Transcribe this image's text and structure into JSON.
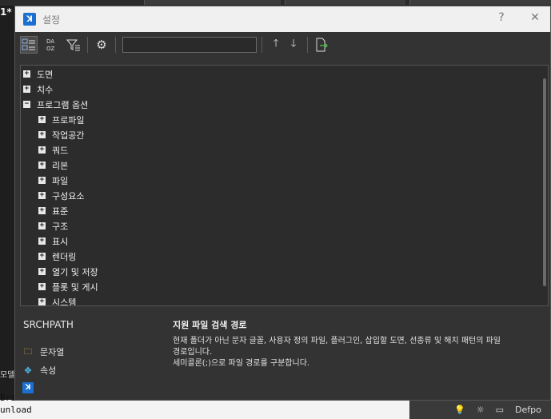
{
  "background": {
    "left_label": "1*",
    "left_label2": "모델",
    "cmd_line1": "  Bri",
    "cmd_line2": "unload",
    "status_layer": "Defpo"
  },
  "dialog": {
    "title": "설정",
    "help_label": "?",
    "close_label": "✕",
    "search": {
      "value": "",
      "placeholder": ""
    },
    "toolbar": {
      "categorized_icon": "categorized-icon",
      "alpha_sort_icon": "alphabetical-sort-icon",
      "filter_icon": "filter-icon",
      "settings_icon": "gear-icon",
      "prev_label": "🡑",
      "next_label": "🡓",
      "export_icon": "export-icon"
    },
    "tree": [
      {
        "label": "도면",
        "level": 0,
        "expander": "+"
      },
      {
        "label": "치수",
        "level": 0,
        "expander": "+"
      },
      {
        "label": "프로그램 옵션",
        "level": 0,
        "expander": "−"
      },
      {
        "label": "프로파일",
        "level": 1,
        "expander": "+"
      },
      {
        "label": "작업공간",
        "level": 1,
        "expander": "+"
      },
      {
        "label": "쿼드",
        "level": 1,
        "expander": "+"
      },
      {
        "label": "리본",
        "level": 1,
        "expander": "+"
      },
      {
        "label": "파일",
        "level": 1,
        "expander": "+"
      },
      {
        "label": "구성요소",
        "level": 1,
        "expander": "+"
      },
      {
        "label": "표준",
        "level": 1,
        "expander": "+"
      },
      {
        "label": "구조",
        "level": 1,
        "expander": "+"
      },
      {
        "label": "표시",
        "level": 1,
        "expander": "+"
      },
      {
        "label": "렌더링",
        "level": 1,
        "expander": "+"
      },
      {
        "label": "열기 및 저장",
        "level": 1,
        "expander": "+"
      },
      {
        "label": "플롯 및 게시",
        "level": 1,
        "expander": "+"
      },
      {
        "label": "시스템",
        "level": 1,
        "expander": "+"
      }
    ],
    "detail": {
      "variable": "SRCHPATH",
      "title": "지원 파일 검색 경로",
      "line1": "현재 폴더가 아닌 문자 글꼴, 사용자 정의 파일, 플러그인, 삽입할 도면, 선종류 및 해치 패턴의 파일",
      "line2": "경로입니다.",
      "line3": "세미콜론(;)으로 파일 경로를 구분합니다."
    },
    "side": {
      "text_label": "문자열",
      "props_label": "속성"
    }
  }
}
